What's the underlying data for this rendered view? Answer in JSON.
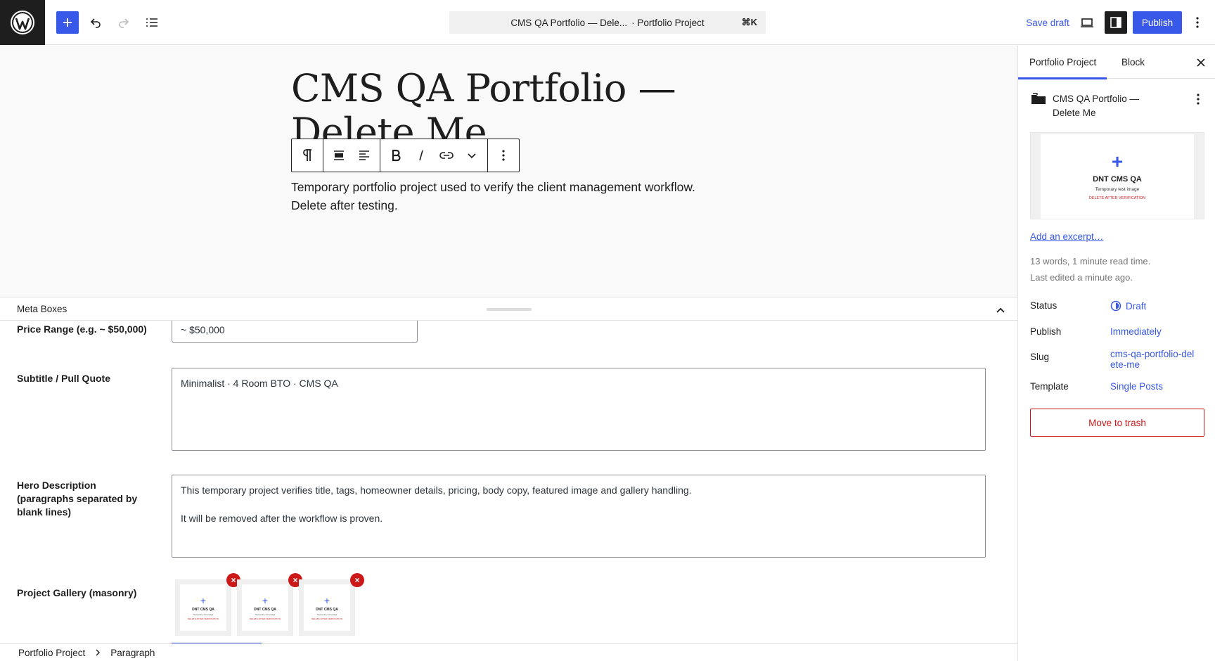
{
  "header": {
    "command_bar": {
      "title": "CMS QA Portfolio — Dele...",
      "post_type": "· Portfolio Project",
      "shortcut": "⌘K"
    },
    "save_draft_label": "Save draft",
    "publish_label": "Publish"
  },
  "editor": {
    "title_line1": "CMS QA Portfolio —",
    "title_line2": "Delete Me",
    "paragraph": "Temporary portfolio project used to verify the client management workflow. Delete after testing."
  },
  "meta_boxes": {
    "header_label": "Meta Boxes",
    "price_range": {
      "label": "Price Range (e.g. ~ $50,000)",
      "value": "~ $50,000"
    },
    "subtitle": {
      "label": "Subtitle / Pull Quote",
      "value": "Minimalist · 4 Room BTO · CMS QA"
    },
    "hero_description": {
      "label": "Hero Description (paragraphs separated by blank lines)",
      "paragraph1": "This temporary project verifies title, tags, homeowner details, pricing, body copy, featured image and gallery handling.",
      "paragraph2": "It will be removed after the workflow is proven."
    },
    "gallery": {
      "label": "Project Gallery (masonry)",
      "thumb_title": "DNT CMS QA",
      "remove_glyph": "×"
    }
  },
  "breadcrumb": {
    "items": [
      "Portfolio Project",
      "Paragraph"
    ]
  },
  "sidebar": {
    "tabs": [
      "Portfolio Project",
      "Block"
    ],
    "post_title": "CMS QA Portfolio — Delete Me",
    "featured_image": {
      "title": "DNT CMS QA",
      "subtitle": "Temporary test image",
      "note": "DELETE AFTER VERIFICATION"
    },
    "excerpt_link": "Add an excerpt…",
    "word_count": "13 words, 1 minute read time.",
    "last_edited": "Last edited a minute ago.",
    "rows": [
      {
        "label": "Status",
        "value": "Draft"
      },
      {
        "label": "Publish",
        "value": "Immediately"
      },
      {
        "label": "Slug",
        "value": "cms-qa-portfolio-delete-me"
      },
      {
        "label": "Template",
        "value": "Single Posts"
      }
    ],
    "trash_label": "Move to trash"
  },
  "colors": {
    "accent": "#3858e9",
    "danger": "#cc1818",
    "dark": "#1e1e1e"
  },
  "icons": [
    "wordpress-logo-icon",
    "plus-icon",
    "undo-icon",
    "redo-icon",
    "list-view-icon",
    "desktop-preview-icon",
    "sidebar-toggle-icon",
    "vertical-ellipsis-icon",
    "pilcrow-icon",
    "align-icon",
    "text-align-left-icon",
    "bold-icon",
    "italic-icon",
    "link-icon",
    "chevron-down-icon",
    "chevron-up-icon",
    "close-icon",
    "folder-icon",
    "draft-status-icon",
    "chevron-right-icon"
  ]
}
